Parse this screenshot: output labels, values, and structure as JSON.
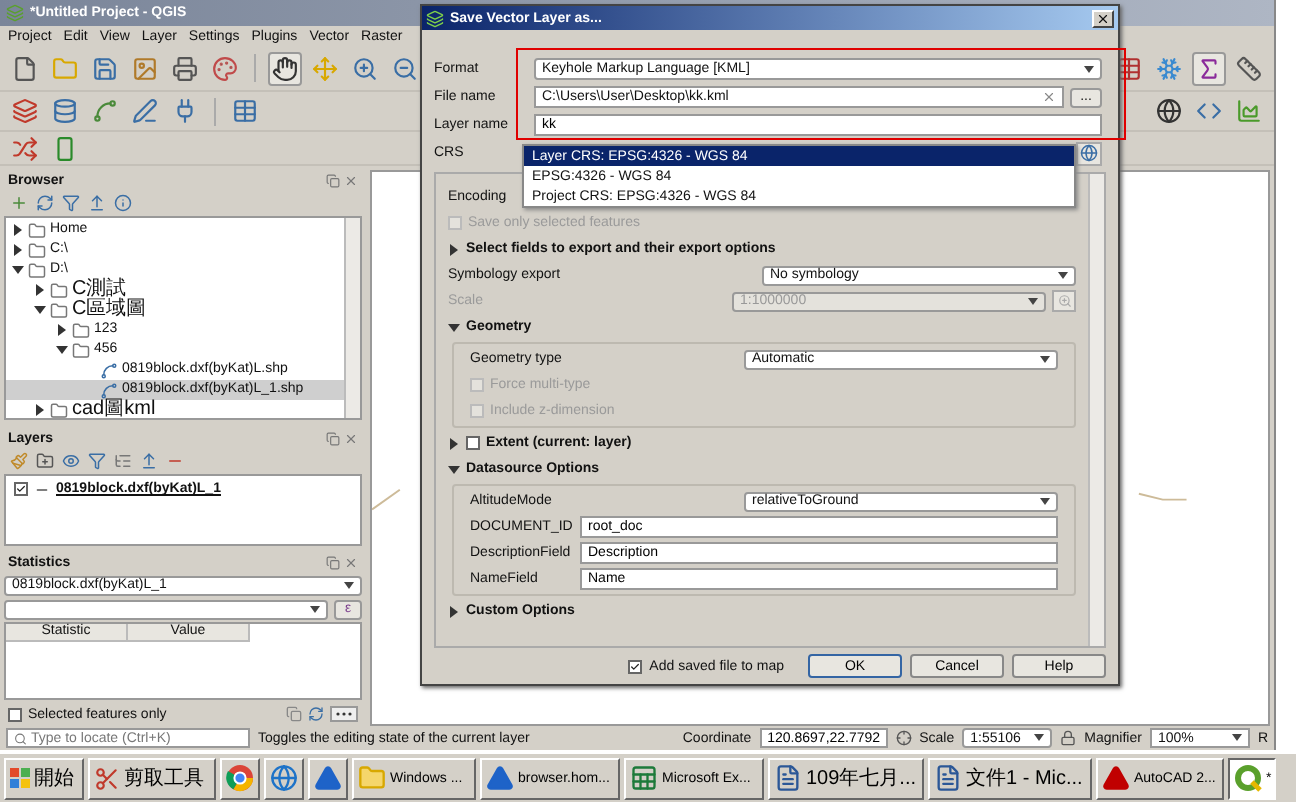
{
  "main_window": {
    "title": "*Untitled Project - QGIS",
    "menu": [
      "Project",
      "Edit",
      "View",
      "Layer",
      "Settings",
      "Plugins",
      "Vector",
      "Raster"
    ]
  },
  "browser": {
    "title": "Browser",
    "tree": [
      {
        "kind": "folder",
        "label": "Home",
        "expanded": false
      },
      {
        "kind": "folder",
        "label": "C:\\",
        "expanded": false
      },
      {
        "kind": "folder",
        "label": "D:\\",
        "expanded": true,
        "children": [
          {
            "kind": "folder",
            "label": "C測試",
            "expanded": false
          },
          {
            "kind": "folder",
            "label": "C區域圖",
            "expanded": true,
            "children": [
              {
                "kind": "folder",
                "label": "123",
                "expanded": false
              },
              {
                "kind": "folder",
                "label": "456",
                "expanded": true,
                "children": [
                  {
                    "kind": "file",
                    "label": "0819block.dxf(byKat)L.shp",
                    "selected": false
                  },
                  {
                    "kind": "file",
                    "label": "0819block.dxf(byKat)L_1.shp",
                    "selected": true
                  }
                ]
              }
            ]
          },
          {
            "kind": "folder",
            "label": "cad圖kml",
            "expanded": false
          }
        ]
      }
    ]
  },
  "layers": {
    "title": "Layers",
    "items": [
      {
        "label": "0819block.dxf(byKat)L_1",
        "checked": true
      }
    ]
  },
  "statistics": {
    "title": "Statistics",
    "layer": "0819block.dxf(byKat)L_1",
    "expression_button": "ε",
    "columns": [
      "Statistic",
      "Value"
    ],
    "selected_only": {
      "label": "Selected features only",
      "checked": false
    }
  },
  "status_bar": {
    "search_placeholder": "Type to locate (Ctrl+K)",
    "message": "Toggles the editing state of the current layer",
    "coordinate_label": "Coordinate",
    "coordinate": "120.8697,22.7792",
    "scale_label": "Scale",
    "scale": "1:55106",
    "magnifier_label": "Magnifier",
    "magnifier": "100%",
    "rotation_label": "R"
  },
  "taskbar": {
    "start": "開始",
    "items": [
      {
        "kind": "scissors",
        "label": "剪取工具",
        "selected": false
      },
      {
        "kind": "ring",
        "selected": false
      },
      {
        "kind": "globe",
        "selected": false
      },
      {
        "kind": "triangle",
        "selected": false
      },
      {
        "kind": "folder",
        "label": "Windows ...",
        "selected": false
      },
      {
        "kind": "triangle",
        "label": "browser.hom...",
        "selected": false
      },
      {
        "kind": "sheet",
        "label": "Microsoft Ex...",
        "selected": false
      },
      {
        "kind": "document",
        "label": "109年七月...",
        "selected": false
      },
      {
        "kind": "document",
        "label": "文件1 - Mic...",
        "selected": false
      },
      {
        "kind": "cad",
        "label": "AutoCAD 2...",
        "selected": false
      },
      {
        "kind": "qgis",
        "label": "*",
        "selected": true
      }
    ]
  },
  "dialog": {
    "title": "Save Vector Layer as...",
    "format": {
      "label": "Format",
      "value": "Keyhole Markup Language [KML]"
    },
    "file_name": {
      "label": "File name",
      "value": "C:\\Users\\User\\Desktop\\kk.kml",
      "browse": "..."
    },
    "layer_name": {
      "label": "Layer name",
      "value": "kk"
    },
    "crs": {
      "label": "CRS",
      "expanded": true,
      "options": [
        {
          "label": "Layer CRS: EPSG:4326 - WGS 84",
          "selected": true
        },
        {
          "label": "EPSG:4326 - WGS 84",
          "selected": false
        },
        {
          "label": "Project CRS: EPSG:4326 - WGS 84",
          "selected": false
        }
      ]
    },
    "options": [
      {
        "kind": "select",
        "label": "Encoding",
        "disabled": false
      },
      {
        "kind": "checkbox",
        "label": "Save only selected features",
        "checked": false,
        "disabled": true
      },
      {
        "kind": "section",
        "label": "Select fields to export and their export options",
        "expanded": false
      },
      {
        "kind": "select",
        "label": "Symbology export",
        "value": "No symbology",
        "disabled": false
      },
      {
        "kind": "select",
        "label": "Scale",
        "value": "1:1000000",
        "disabled": true
      },
      {
        "kind": "section",
        "label": "Geometry",
        "expanded": true,
        "children": [
          {
            "kind": "select",
            "label": "Geometry type",
            "value": "Automatic",
            "disabled": false
          },
          {
            "kind": "checkbox",
            "label": "Force multi-type",
            "checked": false,
            "disabled": true
          },
          {
            "kind": "checkbox",
            "label": "Include z-dimension",
            "checked": false,
            "disabled": true
          }
        ]
      },
      {
        "kind": "checkable_section",
        "label": "Extent (current: layer)",
        "expanded": false,
        "checked": false
      },
      {
        "kind": "section",
        "label": "Datasource Options",
        "expanded": true,
        "children": [
          {
            "kind": "select",
            "label": "AltitudeMode",
            "value": "relativeToGround",
            "disabled": false
          },
          {
            "kind": "text",
            "label": "DOCUMENT_ID",
            "value": "root_doc"
          },
          {
            "kind": "text",
            "label": "DescriptionField",
            "value": "Description"
          },
          {
            "kind": "text",
            "label": "NameField",
            "value": "Name"
          }
        ]
      },
      {
        "kind": "section",
        "label": "Custom Options",
        "expanded": false
      }
    ],
    "add_to_map": {
      "label": "Add saved file to map",
      "checked": true
    },
    "buttons": [
      "OK",
      "Cancel",
      "Help"
    ]
  }
}
